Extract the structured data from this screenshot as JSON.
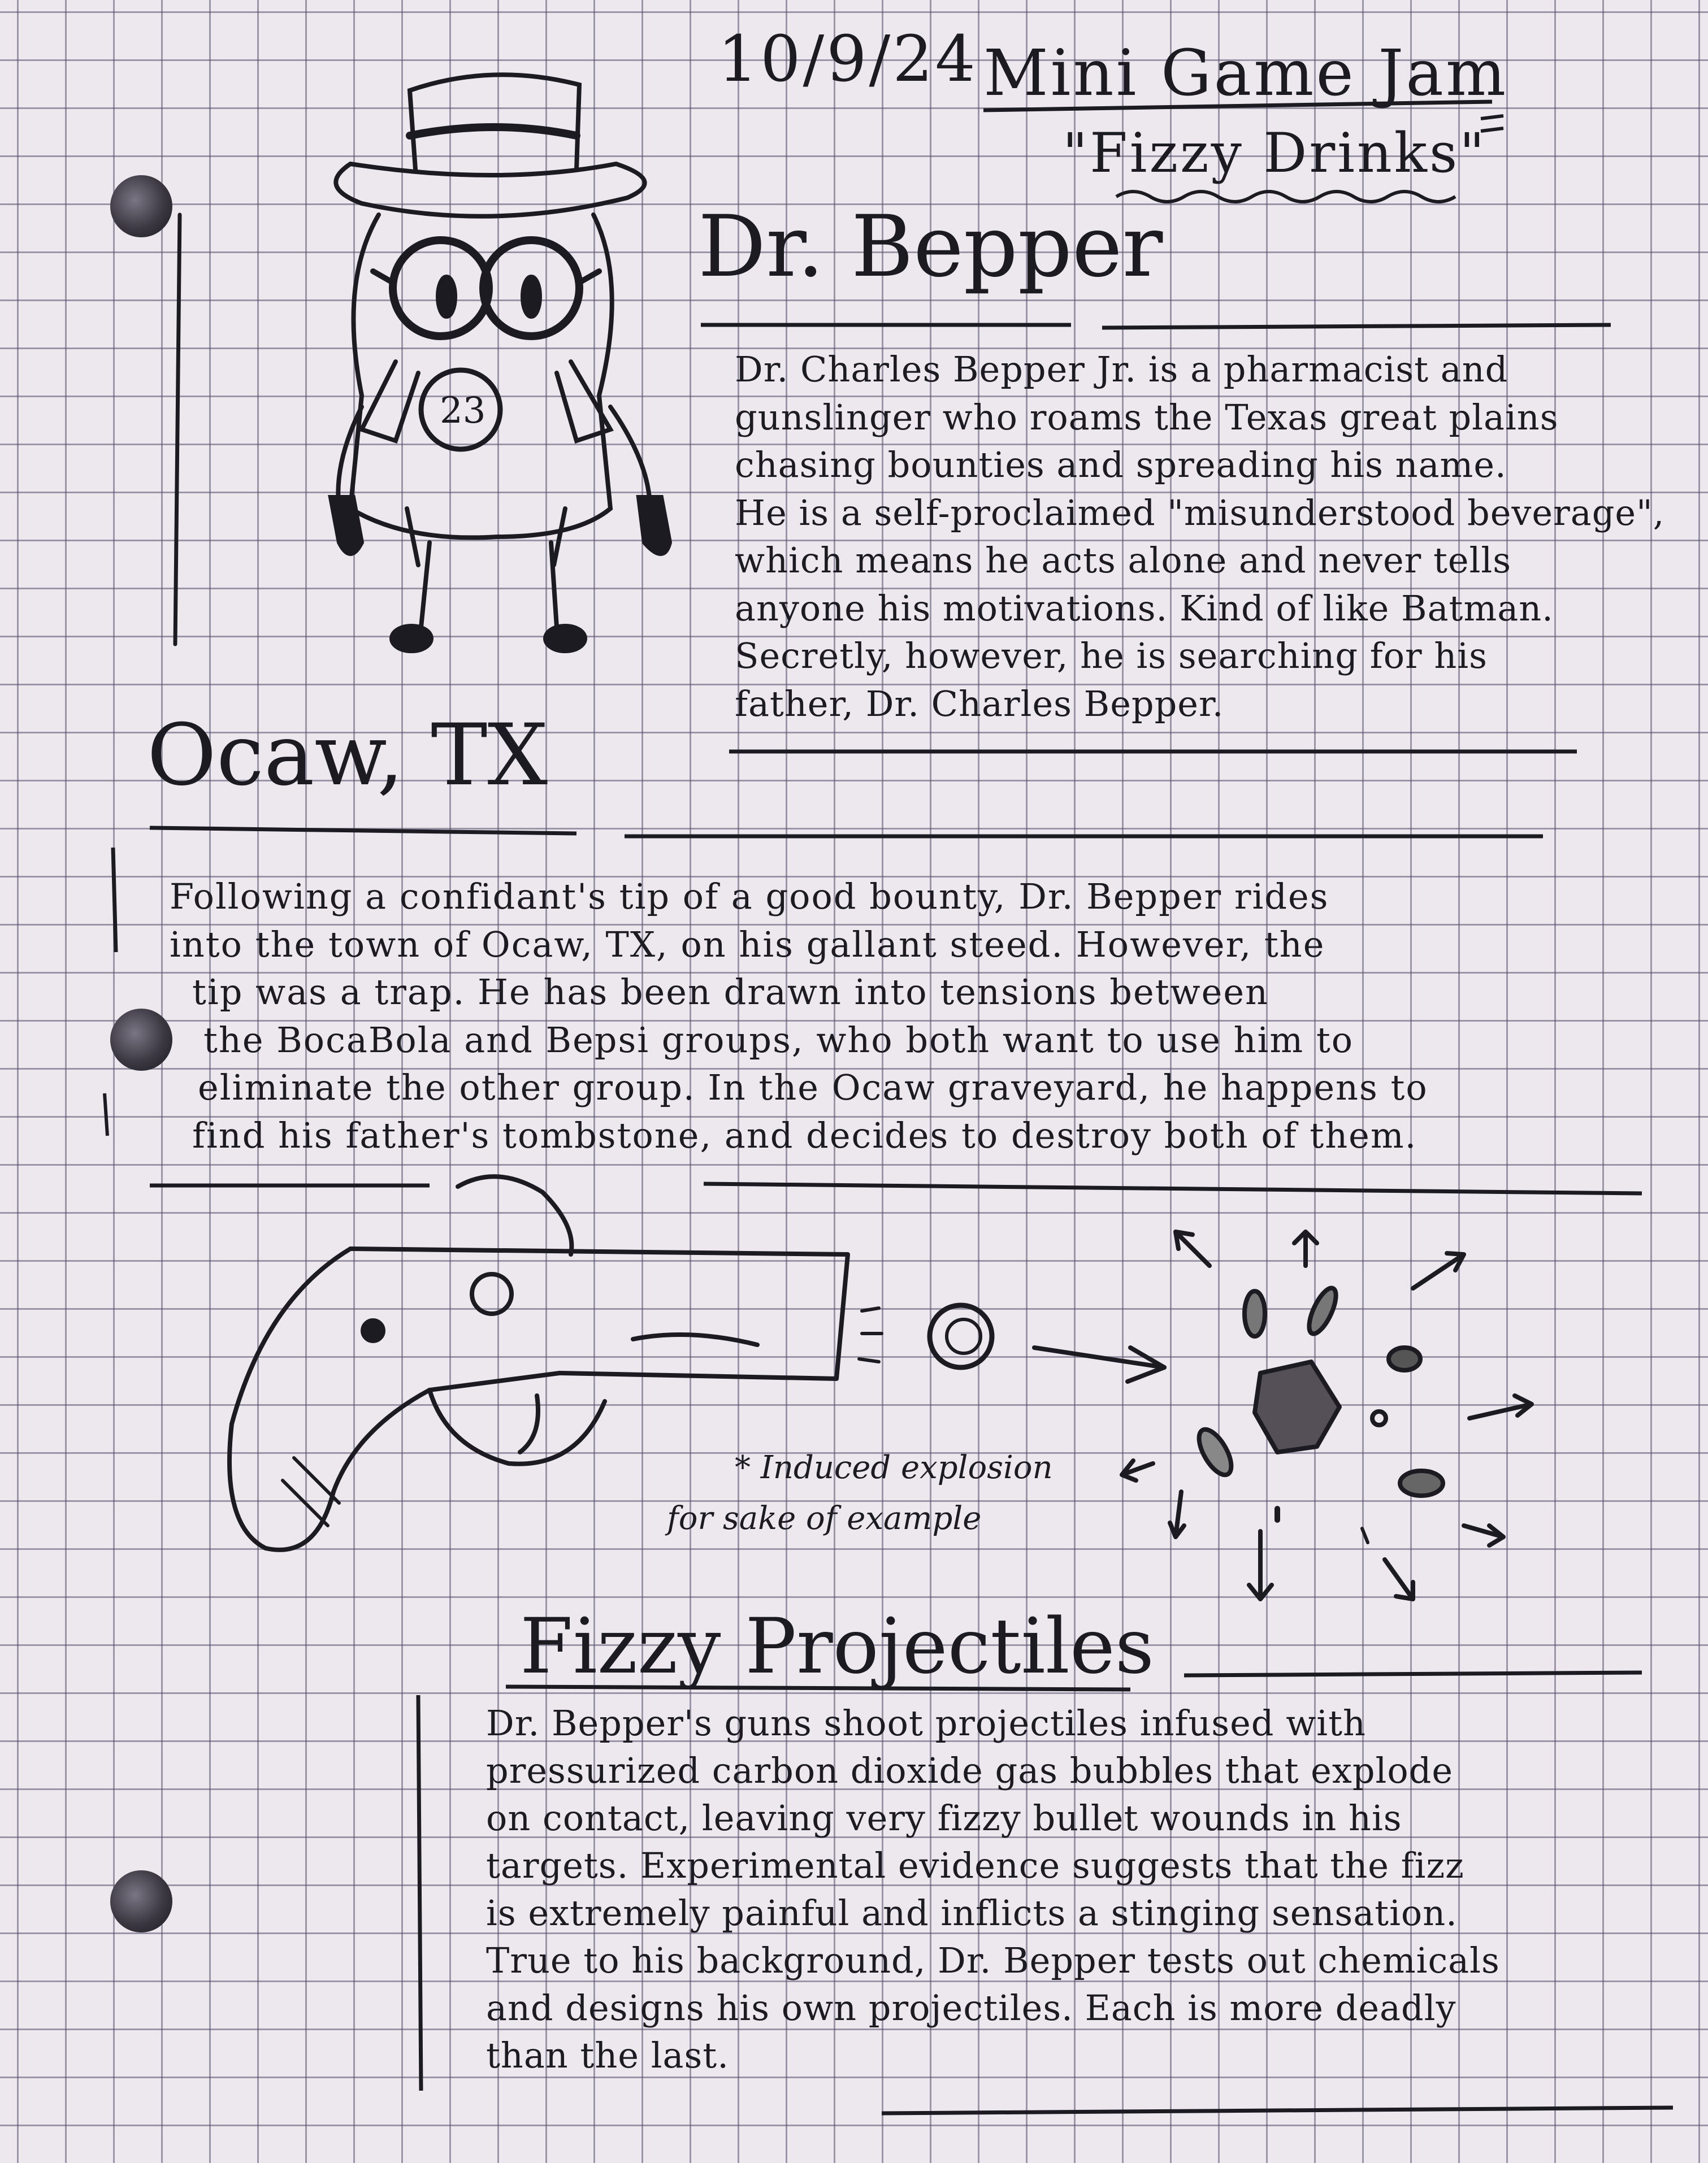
{
  "header": {
    "date": "10/9/24",
    "event": "Mini Game Jam",
    "theme": "\"Fizzy Drinks\""
  },
  "character": {
    "badge_number": "23",
    "title": "Dr. Bepper",
    "lines": [
      "Dr. Charles Bepper Jr. is a pharmacist and",
      "gunslinger who roams the Texas great plains",
      "chasing bounties and spreading his name.",
      "He is a self-proclaimed \"misunderstood beverage\",",
      "which means he acts alone and never tells",
      "anyone his motivations. Kind of like Batman.",
      "Secretly, however, he is searching for his",
      "father, Dr. Charles Bepper."
    ]
  },
  "setting": {
    "title": "Ocaw, TX",
    "lines": [
      "Following a confidant's tip of a good bounty, Dr. Bepper rides",
      "into the town of Ocaw, TX, on his gallant steed. However, the",
      "tip was a trap. He has been drawn into tensions between",
      "the BocaBola and Bepsi groups, who both want to use him to",
      "eliminate the other group. In the Ocaw graveyard, he happens to",
      "find his father's tombstone, and decides to destroy both of them."
    ]
  },
  "sketch": {
    "note_line1": "* Induced explosion",
    "note_line2": "for sake of example"
  },
  "projectiles": {
    "title": "Fizzy Projectiles",
    "lines": [
      "Dr. Bepper's guns shoot projectiles infused with",
      "pressurized carbon dioxide gas bubbles that explode",
      "on contact, leaving very fizzy bullet wounds in his",
      "targets. Experimental evidence suggests that the fizz",
      "is extremely painful and inflicts a stinging sensation.",
      "True to his background, Dr. Bepper tests out chemicals",
      "and designs his own projectiles. Each is more deadly",
      "than the last."
    ]
  }
}
